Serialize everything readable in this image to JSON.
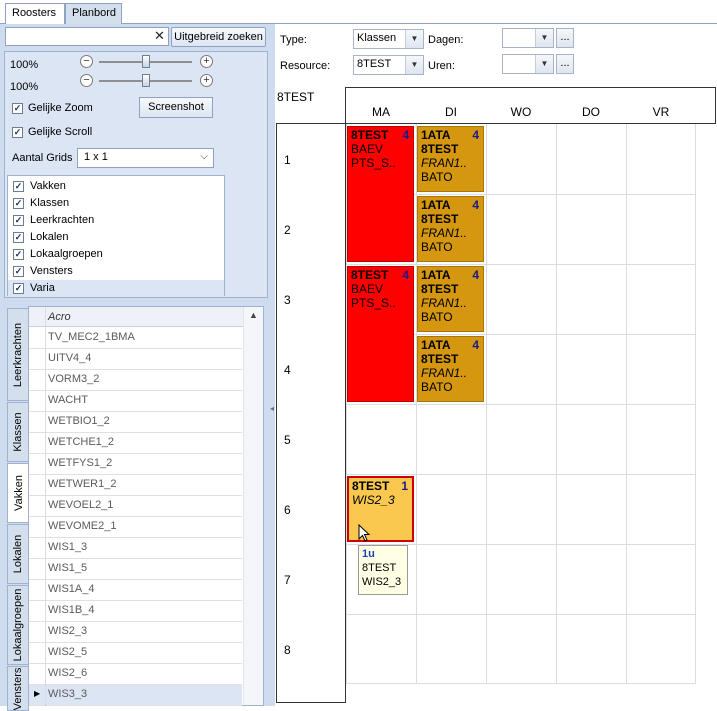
{
  "tabs": [
    {
      "label": "Roosters",
      "active": true
    },
    {
      "label": "Planbord",
      "active": false
    }
  ],
  "search": {
    "value": "",
    "advanced_label": "Uitgebreid zoeken",
    "clear_icon": "close-icon"
  },
  "zoom": [
    {
      "label": "100%",
      "value": 0.5
    },
    {
      "label": "100%",
      "value": 0.5
    }
  ],
  "options": {
    "same_zoom": {
      "label": "Gelijke Zoom",
      "checked": true
    },
    "same_scroll": {
      "label": "Gelijke Scroll",
      "checked": true
    },
    "screenshot_label": "Screenshot",
    "grid_count_label": "Aantal Grids",
    "grid_count_value": "1 x 1"
  },
  "checklist": [
    {
      "label": "Vakken",
      "checked": true
    },
    {
      "label": "Klassen",
      "checked": true
    },
    {
      "label": "Leerkrachten",
      "checked": true
    },
    {
      "label": "Lokalen",
      "checked": true
    },
    {
      "label": "Lokaalgroepen",
      "checked": true
    },
    {
      "label": "Vensters",
      "checked": true
    },
    {
      "label": "Varia",
      "checked": true,
      "selected": true
    }
  ],
  "side_tabs": [
    {
      "label": "Leerkrachten",
      "active": false
    },
    {
      "label": "Klassen",
      "active": false
    },
    {
      "label": "Vakken",
      "active": true
    },
    {
      "label": "Lokalen",
      "active": false
    },
    {
      "label": "Lokaalgroepen",
      "active": false
    },
    {
      "label": "Vensters",
      "active": false
    }
  ],
  "resource_list": {
    "column_header": "Acro",
    "rows": [
      "TV_MEC2_1BMA",
      "UITV4_4",
      "VORM3_2",
      "WACHT",
      "WETBIO1_2",
      "WETCHE1_2",
      "WETFYS1_2",
      "WETWER1_2",
      "WEVOEL2_1",
      "WEVOME2_1",
      "WIS1_3",
      "WIS1_5",
      "WIS1A_4",
      "WIS1B_4",
      "WIS2_3",
      "WIS2_5",
      "WIS2_6",
      "WIS3_3"
    ],
    "selected_row": "WIS3_3"
  },
  "filters": {
    "type_label": "Type:",
    "type_value": "Klassen",
    "resource_label": "Resource:",
    "resource_value": "8TEST",
    "dagen_label": "Dagen:",
    "dagen_value": "",
    "uren_label": "Uren:",
    "uren_value": "",
    "more_label": "..."
  },
  "schedule": {
    "resource_title": "8TEST",
    "days": [
      "MA",
      "DI",
      "WO",
      "DO",
      "VR"
    ],
    "hours": [
      "1",
      "2",
      "3",
      "4",
      "5",
      "6",
      "7",
      "8"
    ],
    "lessons": [
      {
        "day": 0,
        "hour": 0,
        "span": 2,
        "color": "red",
        "lines": [
          "8TEST",
          "BAEV",
          "PTS_S.."
        ],
        "count": "4"
      },
      {
        "day": 1,
        "hour": 0,
        "span": 1,
        "color": "gold",
        "lines": [
          "1ATA",
          "8TEST",
          "FRAN1..",
          "BATO"
        ],
        "count": "4"
      },
      {
        "day": 1,
        "hour": 1,
        "span": 1,
        "color": "gold",
        "lines": [
          "1ATA",
          "8TEST",
          "FRAN1..",
          "BATO"
        ],
        "count": "4"
      },
      {
        "day": 0,
        "hour": 2,
        "span": 2,
        "color": "red",
        "lines": [
          "8TEST",
          "BAEV",
          "PTS_S.."
        ],
        "count": "4"
      },
      {
        "day": 1,
        "hour": 2,
        "span": 1,
        "color": "gold",
        "lines": [
          "1ATA",
          "8TEST",
          "FRAN1..",
          "BATO"
        ],
        "count": "4"
      },
      {
        "day": 1,
        "hour": 3,
        "span": 1,
        "color": "gold",
        "lines": [
          "1ATA",
          "8TEST",
          "FRAN1..",
          "BATO"
        ],
        "count": "4"
      },
      {
        "day": 0,
        "hour": 5,
        "span": 1,
        "color": "yellow",
        "lines": [
          "8TEST",
          "WIS2_3"
        ],
        "count": "1"
      }
    ],
    "tooltip": [
      "1u",
      "8TEST",
      "WIS2_3"
    ]
  },
  "colors": {
    "red": "#ff0000",
    "gold": "#d4970f",
    "yellow": "#fac84f",
    "accent": "#cfdcef"
  }
}
